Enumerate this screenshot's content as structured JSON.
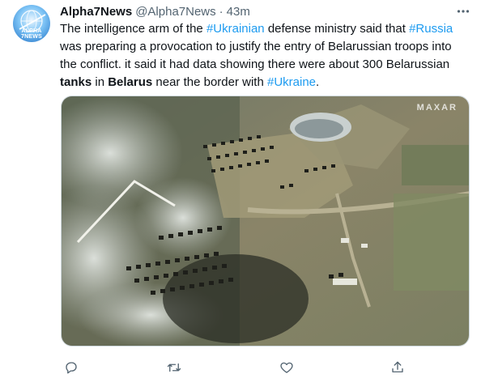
{
  "tweet": {
    "display_name": "Alpha7News",
    "handle": "@Alpha7News",
    "separator": "·",
    "time": "43m",
    "avatar_text": "ALPHA 7NEWS",
    "text_lines": [
      [
        {
          "t": "The intelligence arm of the ",
          "type": "text"
        },
        {
          "t": "#Ukrainian",
          "type": "hashtag"
        },
        {
          "t": " defense ministry said that ",
          "type": "text"
        },
        {
          "t": "#Russia",
          "type": "hashtag"
        }
      ],
      [
        {
          "t": "was preparing a provocation to justify the entry of Belarussian troops into",
          "type": "text"
        }
      ],
      [
        {
          "t": "the conflict. it said it had data showing there were about 300 Belarussian",
          "type": "text"
        }
      ],
      [
        {
          "t": "tanks",
          "type": "bold"
        },
        {
          "t": " in ",
          "type": "text"
        },
        {
          "t": "Belarus",
          "type": "bold"
        },
        {
          "t": " near the border with ",
          "type": "text"
        },
        {
          "t": "#Ukraine",
          "type": "hashtag"
        },
        {
          "t": ".",
          "type": "text"
        }
      ]
    ],
    "media": {
      "watermark": "MAXAR"
    }
  },
  "actions": [
    {
      "name": "reply",
      "icon": "reply-icon"
    },
    {
      "name": "retweet",
      "icon": "retweet-icon"
    },
    {
      "name": "like",
      "icon": "heart-icon"
    },
    {
      "name": "share",
      "icon": "share-icon"
    }
  ],
  "colors": {
    "hashtag": "#1d9bf0",
    "text": "#0f1419",
    "secondary": "#536471",
    "border": "#cfd9de"
  }
}
